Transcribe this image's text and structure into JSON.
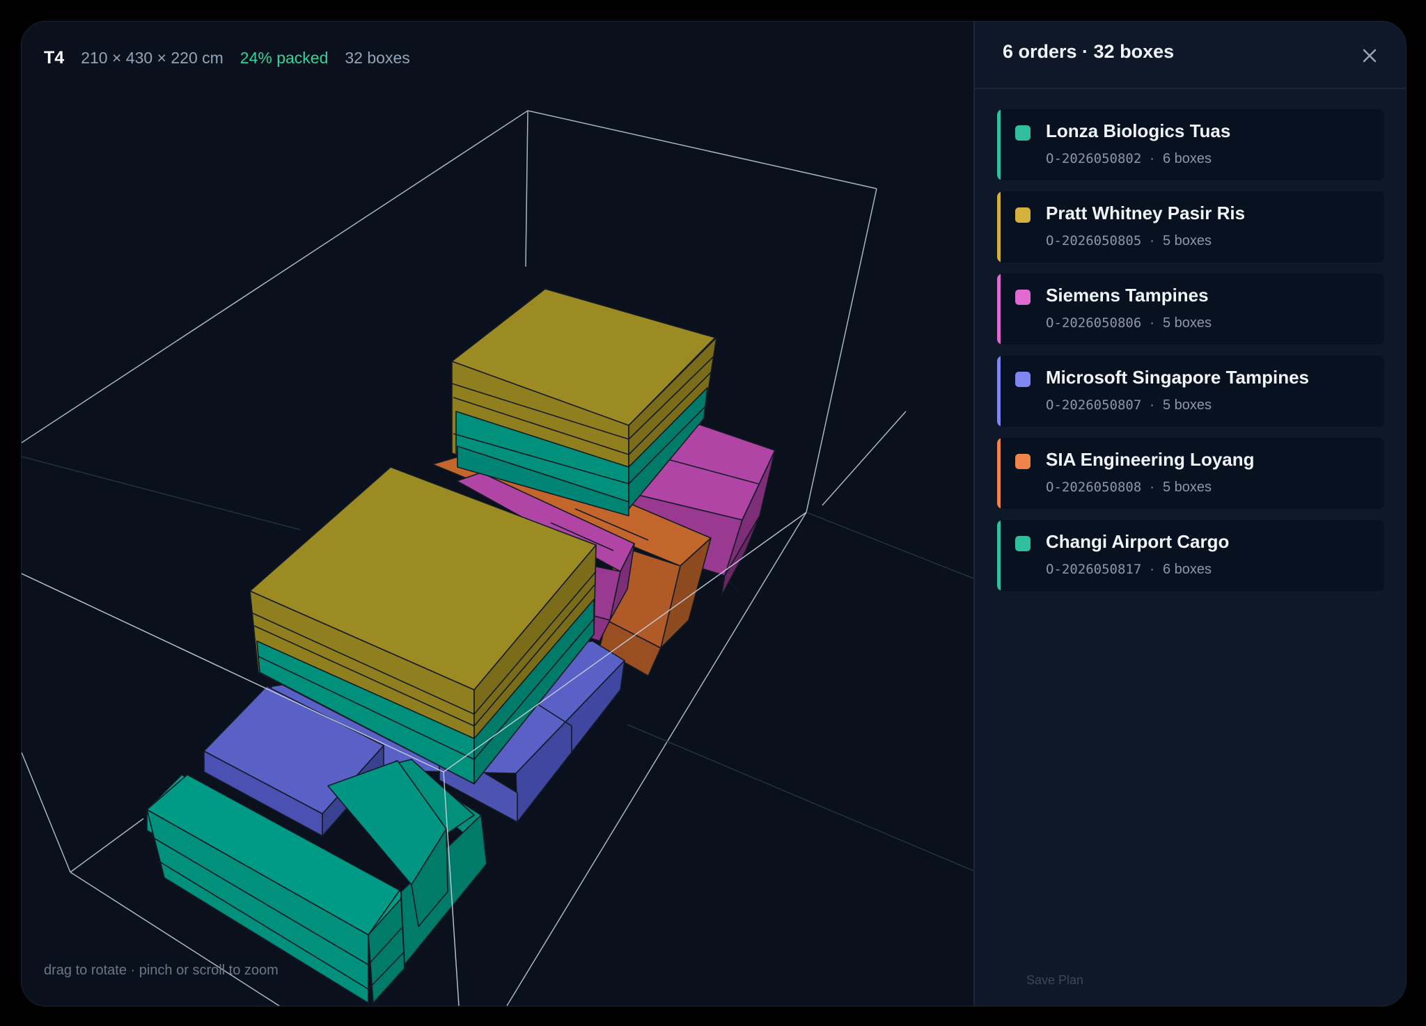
{
  "viewer": {
    "truck_id": "T4",
    "dimensions": "210 × 430 × 220 cm",
    "packed": "24% packed",
    "box_count": "32 boxes",
    "hint": "drag to rotate · pinch or scroll to zoom",
    "colors": {
      "packed": "#34d399",
      "teal": "#009b86",
      "gold": "#9c8a23",
      "magenta": "#b045a6",
      "blue": "#5961c6",
      "orange": "#c2662c",
      "wireframe": "#c9d1dc"
    }
  },
  "panel": {
    "title": "6 orders · 32 boxes",
    "close_icon": "close-icon",
    "orders": [
      {
        "name": "Lonza Biologics Tuas",
        "code": "O-2026050802",
        "boxes": "6 boxes",
        "color": "#2fbf9f"
      },
      {
        "name": "Pratt Whitney Pasir Ris",
        "code": "O-2026050805",
        "boxes": "5 boxes",
        "color": "#d4b13a"
      },
      {
        "name": "Siemens Tampines",
        "code": "O-2026050806",
        "boxes": "5 boxes",
        "color": "#e06ad0"
      },
      {
        "name": "Microsoft Singapore Tampines",
        "code": "O-2026050807",
        "boxes": "5 boxes",
        "color": "#7f86f0"
      },
      {
        "name": "SIA Engineering Loyang",
        "code": "O-2026050808",
        "boxes": "5 boxes",
        "color": "#f0844a"
      },
      {
        "name": "Changi Airport Cargo",
        "code": "O-2026050817",
        "boxes": "6 boxes",
        "color": "#2fbf9f"
      }
    ],
    "separator": "·",
    "footer_ghost": "Save Plan"
  }
}
